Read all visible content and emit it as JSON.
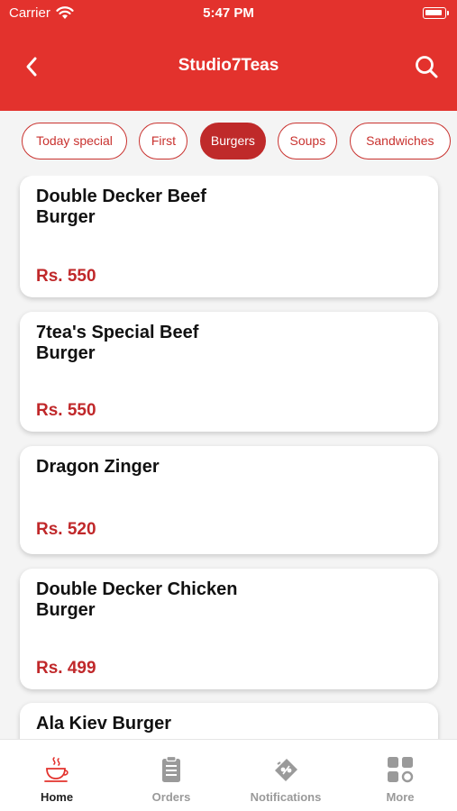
{
  "status": {
    "carrier": "Carrier",
    "time": "5:47 PM"
  },
  "header": {
    "title": "Studio7Teas"
  },
  "categories": [
    "Today special",
    "First",
    "Burgers",
    "Soups",
    "Sandwiches"
  ],
  "selected_category": "Burgers",
  "items": [
    {
      "name": "Double Decker Beef Burger",
      "price": "Rs. 550"
    },
    {
      "name": "7tea's Special Beef Burger",
      "price": "Rs. 550"
    },
    {
      "name": "Dragon Zinger",
      "price": "Rs. 520"
    },
    {
      "name": "Double Decker Chicken Burger",
      "price": "Rs. 499"
    },
    {
      "name": "Ala Kiev Burger",
      "price": ""
    }
  ],
  "tabs": [
    {
      "label": "Home",
      "icon": "home-cup-icon"
    },
    {
      "label": "Orders",
      "icon": "clipboard-icon"
    },
    {
      "label": "Notifications",
      "icon": "coupon-icon"
    },
    {
      "label": "More",
      "icon": "grid-icon"
    }
  ],
  "colors": {
    "brand": "#e3322d",
    "accent": "#bf2a2a",
    "price": "#c0282a"
  }
}
